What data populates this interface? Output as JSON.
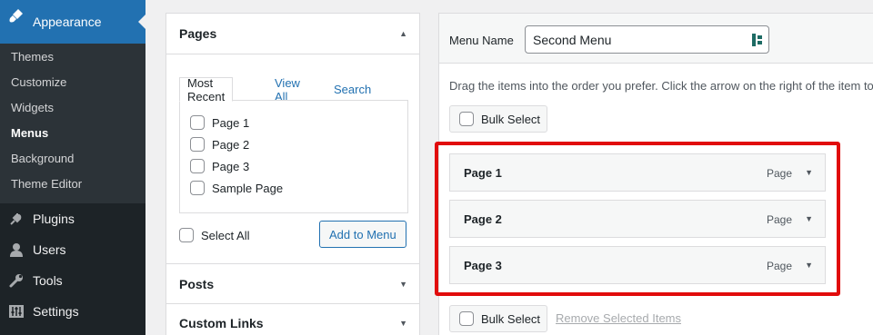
{
  "sidebar": {
    "current": {
      "label": "Appearance",
      "icon": "paintbrush-icon"
    },
    "submenu": [
      "Themes",
      "Customize",
      "Widgets",
      "Menus",
      "Background",
      "Theme Editor"
    ],
    "items": [
      {
        "label": "Plugins",
        "icon": "plugin-icon"
      },
      {
        "label": "Users",
        "icon": "users-icon"
      },
      {
        "label": "Tools",
        "icon": "wrench-icon"
      },
      {
        "label": "Settings",
        "icon": "settings-icon"
      }
    ]
  },
  "add_items": {
    "pages_heading": "Pages",
    "tabs": [
      "Most Recent",
      "View All",
      "Search"
    ],
    "pages": [
      "Page 1",
      "Page 2",
      "Page 3",
      "Sample Page"
    ],
    "select_all": "Select All",
    "add_button": "Add to Menu",
    "posts_heading": "Posts",
    "custom_links_heading": "Custom Links"
  },
  "menu_structure": {
    "menu_name_label": "Menu Name",
    "menu_name_value": "Second Menu",
    "instructions": "Drag the items into the order you prefer. Click the arrow on the right of the item to",
    "bulk_select": "Bulk Select",
    "items": [
      {
        "title": "Page 1",
        "type": "Page"
      },
      {
        "title": "Page 2",
        "type": "Page"
      },
      {
        "title": "Page 3",
        "type": "Page"
      }
    ],
    "remove_selected": "Remove Selected Items"
  },
  "colors": {
    "accent": "#2271b1",
    "sidebar_bg": "#1d2327",
    "highlight": "#e10c0c"
  }
}
